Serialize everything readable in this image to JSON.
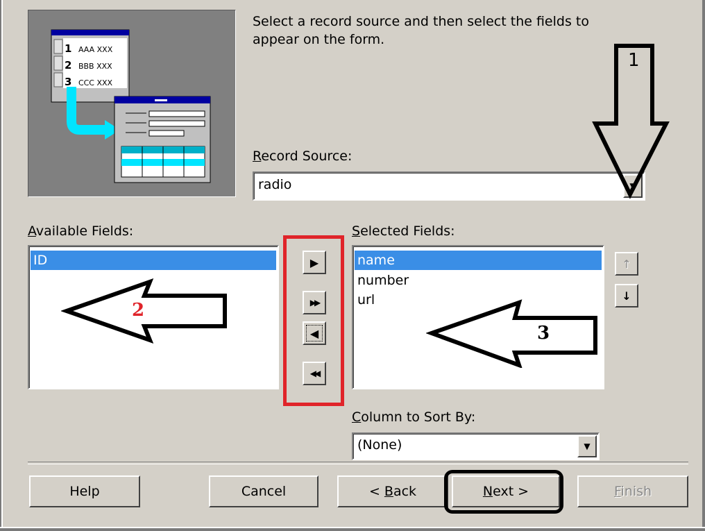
{
  "description": "Select a record source and then select the fields to appear on the form.",
  "illustration": {
    "rows": [
      {
        "num": "1",
        "text": "AAA XXX"
      },
      {
        "num": "2",
        "text": "BBB XXX"
      },
      {
        "num": "3",
        "text": "CCC XXX"
      }
    ]
  },
  "record_source": {
    "label_first": "R",
    "label_rest": "ecord Source:",
    "value": "radio"
  },
  "available_fields": {
    "label_first": "A",
    "label_rest": "vailable Fields:",
    "items": [
      "ID"
    ]
  },
  "selected_fields": {
    "label_first": "S",
    "label_rest": "elected Fields:",
    "items": [
      "name",
      "number",
      "url"
    ]
  },
  "move_buttons": {
    "add_one": "▶",
    "add_all": "▶▶",
    "remove_one": "◀",
    "remove_all": "◀◀"
  },
  "order_buttons": {
    "up": "↑",
    "down": "↓"
  },
  "sort": {
    "label_first": "C",
    "label_rest": "olumn to Sort By:",
    "value": "(None)"
  },
  "buttons": {
    "help": "Help",
    "cancel": "Cancel",
    "back_prefix": "< ",
    "back_key": "B",
    "back_rest": "ack",
    "next_key": "N",
    "next_rest": "ext >",
    "finish_key": "F",
    "finish_rest": "inish"
  },
  "annotations": {
    "one": "1",
    "two": "2",
    "three": "3"
  },
  "colors": {
    "selection": "#3a8ee6",
    "highlight_red": "#e0242a",
    "dialog_bg": "#d4d0c8"
  }
}
